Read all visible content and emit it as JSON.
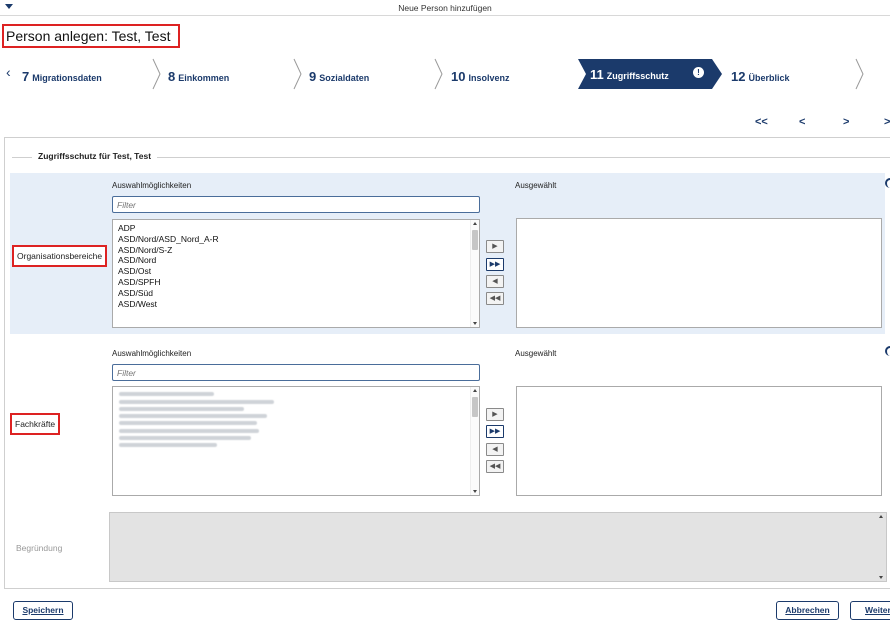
{
  "window": {
    "title": "Neue Person hinzufügen"
  },
  "page": {
    "title": "Person anlegen: Test, Test"
  },
  "steps": {
    "prev_icon": "chevron-left-icon",
    "items": [
      {
        "num": "7",
        "label": "Migrationsdaten"
      },
      {
        "num": "8",
        "label": "Einkommen"
      },
      {
        "num": "9",
        "label": "Sozialdaten"
      },
      {
        "num": "10",
        "label": "Insolvenz"
      },
      {
        "num": "11",
        "label": "Zugriffsschutz",
        "active": true,
        "info_icon": "info-icon"
      },
      {
        "num": "12",
        "label": "Überblick"
      }
    ],
    "next_icon": "chevron-right-icon"
  },
  "nav": {
    "first": "<<",
    "prev": "<",
    "next": ">",
    "last": ">"
  },
  "section": {
    "legend": "Zugriffsschutz für Test, Test",
    "organisationsbereiche": {
      "label": "Organisationsbereiche",
      "options_header": "Auswahlmöglichkeiten",
      "selected_header": "Ausgewählt",
      "filter_placeholder": "Filter",
      "options": [
        "ADP",
        "ASD/Nord/ASD_Nord_A-R",
        "ASD/Nord/S-Z",
        "ASD/Nord",
        "ASD/Ost",
        "ASD/SPFH",
        "ASD/Süd",
        "ASD/West"
      ],
      "selected": []
    },
    "fachkraefte": {
      "label": "Fachkräfte",
      "options_header": "Auswahlmöglichkeiten",
      "selected_header": "Ausgewählt",
      "filter_placeholder": "Filter",
      "options_redacted": true,
      "selected": []
    },
    "move_buttons": {
      "add": "▶",
      "add_all": "▶▶",
      "remove": "◀",
      "remove_all": "◀◀"
    },
    "begruendung": {
      "label": "Begründung",
      "value": ""
    }
  },
  "footer": {
    "save": "Speichern",
    "cancel": "Abbrechen",
    "next": "Weiter"
  },
  "colors": {
    "brand": "#1b3a6b",
    "highlight": "#dd2222",
    "band": "#e6eef8"
  }
}
